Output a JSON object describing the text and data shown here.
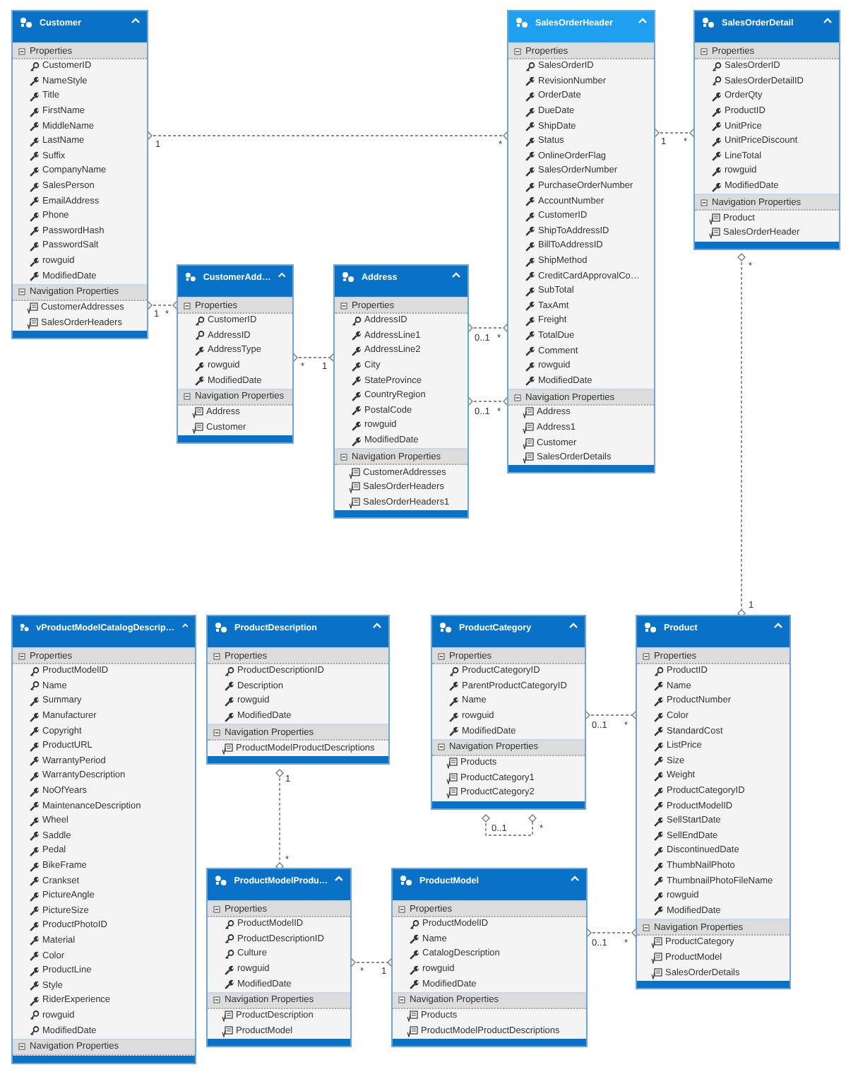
{
  "entities": [
    {
      "title": "Customer",
      "selected": false,
      "sections": [
        {
          "label": "Properties",
          "items": [
            {
              "name": "CustomerID",
              "kind": "key"
            },
            {
              "name": "NameStyle",
              "kind": "property"
            },
            {
              "name": "Title",
              "kind": "property"
            },
            {
              "name": "FirstName",
              "kind": "property"
            },
            {
              "name": "MiddleName",
              "kind": "property"
            },
            {
              "name": "LastName",
              "kind": "property"
            },
            {
              "name": "Suffix",
              "kind": "property"
            },
            {
              "name": "CompanyName",
              "kind": "property"
            },
            {
              "name": "SalesPerson",
              "kind": "property"
            },
            {
              "name": "EmailAddress",
              "kind": "property"
            },
            {
              "name": "Phone",
              "kind": "property"
            },
            {
              "name": "PasswordHash",
              "kind": "property"
            },
            {
              "name": "PasswordSalt",
              "kind": "property"
            },
            {
              "name": "rowguid",
              "kind": "property"
            },
            {
              "name": "ModifiedDate",
              "kind": "property"
            }
          ]
        },
        {
          "label": "Navigation Properties",
          "items": [
            {
              "name": "CustomerAddresses",
              "kind": "navigation"
            },
            {
              "name": "SalesOrderHeaders",
              "kind": "navigation"
            }
          ]
        }
      ]
    },
    {
      "title": "SalesOrderHeader",
      "selected": true,
      "sections": [
        {
          "label": "Properties",
          "items": [
            {
              "name": "SalesOrderID",
              "kind": "key"
            },
            {
              "name": "RevisionNumber",
              "kind": "property"
            },
            {
              "name": "OrderDate",
              "kind": "property"
            },
            {
              "name": "DueDate",
              "kind": "property"
            },
            {
              "name": "ShipDate",
              "kind": "property"
            },
            {
              "name": "Status",
              "kind": "property"
            },
            {
              "name": "OnlineOrderFlag",
              "kind": "property"
            },
            {
              "name": "SalesOrderNumber",
              "kind": "property"
            },
            {
              "name": "PurchaseOrderNumber",
              "kind": "property"
            },
            {
              "name": "AccountNumber",
              "kind": "property"
            },
            {
              "name": "CustomerID",
              "kind": "property"
            },
            {
              "name": "ShipToAddressID",
              "kind": "property"
            },
            {
              "name": "BillToAddressID",
              "kind": "property"
            },
            {
              "name": "ShipMethod",
              "kind": "property"
            },
            {
              "name": "CreditCardApprovalCo…",
              "kind": "property"
            },
            {
              "name": "SubTotal",
              "kind": "property"
            },
            {
              "name": "TaxAmt",
              "kind": "property"
            },
            {
              "name": "Freight",
              "kind": "property"
            },
            {
              "name": "TotalDue",
              "kind": "property"
            },
            {
              "name": "Comment",
              "kind": "property"
            },
            {
              "name": "rowguid",
              "kind": "property"
            },
            {
              "name": "ModifiedDate",
              "kind": "property"
            }
          ]
        },
        {
          "label": "Navigation Properties",
          "items": [
            {
              "name": "Address",
              "kind": "navigation"
            },
            {
              "name": "Address1",
              "kind": "navigation"
            },
            {
              "name": "Customer",
              "kind": "navigation"
            },
            {
              "name": "SalesOrderDetails",
              "kind": "navigation"
            }
          ]
        }
      ]
    },
    {
      "title": "SalesOrderDetail",
      "selected": false,
      "sections": [
        {
          "label": "Properties",
          "items": [
            {
              "name": "SalesOrderID",
              "kind": "key"
            },
            {
              "name": "SalesOrderDetailID",
              "kind": "key"
            },
            {
              "name": "OrderQty",
              "kind": "property"
            },
            {
              "name": "ProductID",
              "kind": "property"
            },
            {
              "name": "UnitPrice",
              "kind": "property"
            },
            {
              "name": "UnitPriceDiscount",
              "kind": "property"
            },
            {
              "name": "LineTotal",
              "kind": "property"
            },
            {
              "name": "rowguid",
              "kind": "property"
            },
            {
              "name": "ModifiedDate",
              "kind": "property"
            }
          ]
        },
        {
          "label": "Navigation Properties",
          "items": [
            {
              "name": "Product",
              "kind": "navigation"
            },
            {
              "name": "SalesOrderHeader",
              "kind": "navigation"
            }
          ]
        }
      ]
    },
    {
      "title": "CustomerAdd…",
      "selected": false,
      "sections": [
        {
          "label": "Properties",
          "items": [
            {
              "name": "CustomerID",
              "kind": "key"
            },
            {
              "name": "AddressID",
              "kind": "key"
            },
            {
              "name": "AddressType",
              "kind": "property"
            },
            {
              "name": "rowguid",
              "kind": "property"
            },
            {
              "name": "ModifiedDate",
              "kind": "property"
            }
          ]
        },
        {
          "label": "Navigation Properties",
          "items": [
            {
              "name": "Address",
              "kind": "navigation"
            },
            {
              "name": "Customer",
              "kind": "navigation"
            }
          ]
        }
      ]
    },
    {
      "title": "Address",
      "selected": false,
      "sections": [
        {
          "label": "Properties",
          "items": [
            {
              "name": "AddressID",
              "kind": "key"
            },
            {
              "name": "AddressLine1",
              "kind": "property"
            },
            {
              "name": "AddressLine2",
              "kind": "property"
            },
            {
              "name": "City",
              "kind": "property"
            },
            {
              "name": "StateProvince",
              "kind": "property"
            },
            {
              "name": "CountryRegion",
              "kind": "property"
            },
            {
              "name": "PostalCode",
              "kind": "property"
            },
            {
              "name": "rowguid",
              "kind": "property"
            },
            {
              "name": "ModifiedDate",
              "kind": "property"
            }
          ]
        },
        {
          "label": "Navigation Properties",
          "items": [
            {
              "name": "CustomerAddresses",
              "kind": "navigation"
            },
            {
              "name": "SalesOrderHeaders",
              "kind": "navigation"
            },
            {
              "name": "SalesOrderHeaders1",
              "kind": "navigation"
            }
          ]
        }
      ]
    },
    {
      "title": "vProductModelCatalogDescrip…",
      "selected": false,
      "sections": [
        {
          "label": "Properties",
          "items": [
            {
              "name": "ProductModelID",
              "kind": "key"
            },
            {
              "name": "Name",
              "kind": "key"
            },
            {
              "name": "Summary",
              "kind": "property"
            },
            {
              "name": "Manufacturer",
              "kind": "property"
            },
            {
              "name": "Copyright",
              "kind": "property"
            },
            {
              "name": "ProductURL",
              "kind": "property"
            },
            {
              "name": "WarrantyPeriod",
              "kind": "property"
            },
            {
              "name": "WarrantyDescription",
              "kind": "property"
            },
            {
              "name": "NoOfYears",
              "kind": "property"
            },
            {
              "name": "MaintenanceDescription",
              "kind": "property"
            },
            {
              "name": "Wheel",
              "kind": "property"
            },
            {
              "name": "Saddle",
              "kind": "property"
            },
            {
              "name": "Pedal",
              "kind": "property"
            },
            {
              "name": "BikeFrame",
              "kind": "property"
            },
            {
              "name": "Crankset",
              "kind": "property"
            },
            {
              "name": "PictureAngle",
              "kind": "property"
            },
            {
              "name": "PictureSize",
              "kind": "property"
            },
            {
              "name": "ProductPhotoID",
              "kind": "property"
            },
            {
              "name": "Material",
              "kind": "property"
            },
            {
              "name": "Color",
              "kind": "property"
            },
            {
              "name": "ProductLine",
              "kind": "property"
            },
            {
              "name": "Style",
              "kind": "property"
            },
            {
              "name": "RiderExperience",
              "kind": "property"
            },
            {
              "name": "rowguid",
              "kind": "key"
            },
            {
              "name": "ModifiedDate",
              "kind": "key"
            }
          ]
        },
        {
          "label": "Navigation Properties"
        }
      ]
    },
    {
      "title": "ProductDescription",
      "selected": false,
      "sections": [
        {
          "label": "Properties",
          "items": [
            {
              "name": "ProductDescriptionID",
              "kind": "key"
            },
            {
              "name": "Description",
              "kind": "property"
            },
            {
              "name": "rowguid",
              "kind": "property"
            },
            {
              "name": "ModifiedDate",
              "kind": "property"
            }
          ]
        },
        {
          "label": "Navigation Properties",
          "items": [
            {
              "name": "ProductModelProductDescriptions",
              "kind": "navigation"
            }
          ]
        }
      ]
    },
    {
      "title": "ProductCategory",
      "selected": false,
      "sections": [
        {
          "label": "Properties",
          "items": [
            {
              "name": "ProductCategoryID",
              "kind": "key"
            },
            {
              "name": "ParentProductCategoryID",
              "kind": "property"
            },
            {
              "name": "Name",
              "kind": "property"
            },
            {
              "name": "rowguid",
              "kind": "property"
            },
            {
              "name": "ModifiedDate",
              "kind": "property"
            }
          ]
        },
        {
          "label": "Navigation Properties",
          "items": [
            {
              "name": "Products",
              "kind": "navigation"
            },
            {
              "name": "ProductCategory1",
              "kind": "navigation"
            },
            {
              "name": "ProductCategory2",
              "kind": "navigation"
            }
          ]
        }
      ]
    },
    {
      "title": "Product",
      "selected": false,
      "sections": [
        {
          "label": "Properties",
          "items": [
            {
              "name": "ProductID",
              "kind": "key"
            },
            {
              "name": "Name",
              "kind": "property"
            },
            {
              "name": "ProductNumber",
              "kind": "property"
            },
            {
              "name": "Color",
              "kind": "property"
            },
            {
              "name": "StandardCost",
              "kind": "property"
            },
            {
              "name": "ListPrice",
              "kind": "property"
            },
            {
              "name": "Size",
              "kind": "property"
            },
            {
              "name": "Weight",
              "kind": "property"
            },
            {
              "name": "ProductCategoryID",
              "kind": "property"
            },
            {
              "name": "ProductModelID",
              "kind": "property"
            },
            {
              "name": "SellStartDate",
              "kind": "property"
            },
            {
              "name": "SellEndDate",
              "kind": "property"
            },
            {
              "name": "DiscontinuedDate",
              "kind": "property"
            },
            {
              "name": "ThumbNailPhoto",
              "kind": "property"
            },
            {
              "name": "ThumbnailPhotoFileName",
              "kind": "property"
            },
            {
              "name": "rowguid",
              "kind": "property"
            },
            {
              "name": "ModifiedDate",
              "kind": "property"
            }
          ]
        },
        {
          "label": "Navigation Properties",
          "items": [
            {
              "name": "ProductCategory",
              "kind": "navigation"
            },
            {
              "name": "ProductModel",
              "kind": "navigation"
            },
            {
              "name": "SalesOrderDetails",
              "kind": "navigation"
            }
          ]
        }
      ]
    },
    {
      "title": "ProductModelProdu…",
      "selected": false,
      "sections": [
        {
          "label": "Properties",
          "items": [
            {
              "name": "ProductModelID",
              "kind": "key"
            },
            {
              "name": "ProductDescriptionID",
              "kind": "key"
            },
            {
              "name": "Culture",
              "kind": "key"
            },
            {
              "name": "rowguid",
              "kind": "property"
            },
            {
              "name": "ModifiedDate",
              "kind": "property"
            }
          ]
        },
        {
          "label": "Navigation Properties",
          "items": [
            {
              "name": "ProductDescription",
              "kind": "navigation"
            },
            {
              "name": "ProductModel",
              "kind": "navigation"
            }
          ]
        }
      ]
    },
    {
      "title": "ProductModel",
      "selected": false,
      "sections": [
        {
          "label": "Properties",
          "items": [
            {
              "name": "ProductModelID",
              "kind": "key"
            },
            {
              "name": "Name",
              "kind": "property"
            },
            {
              "name": "CatalogDescription",
              "kind": "property"
            },
            {
              "name": "rowguid",
              "kind": "property"
            },
            {
              "name": "ModifiedDate",
              "kind": "property"
            }
          ]
        },
        {
          "label": "Navigation Properties",
          "items": [
            {
              "name": "Products",
              "kind": "navigation"
            },
            {
              "name": "ProductModelProductDescriptions",
              "kind": "navigation"
            }
          ]
        }
      ]
    }
  ],
  "associations": [
    {
      "end_1": "1",
      "end_2": "*"
    },
    {
      "end_1": "1",
      "end_2": "*"
    },
    {
      "end_1": "*",
      "end_2": "1"
    },
    {
      "end_1": "0..1",
      "end_2": "*"
    },
    {
      "end_1": "0..1",
      "end_2": "*"
    },
    {
      "end_1": "1",
      "end_2": "*"
    },
    {
      "end_1": "*",
      "end_2": "1"
    },
    {
      "end_1": "1",
      "end_2": "*"
    },
    {
      "end_1": "*",
      "end_2": "1"
    },
    {
      "end_1": "0..1",
      "end_2": "*"
    },
    {
      "end_1": "0..1",
      "end_2": "*"
    },
    {
      "end_1": "0..1",
      "end_2": "*"
    }
  ]
}
